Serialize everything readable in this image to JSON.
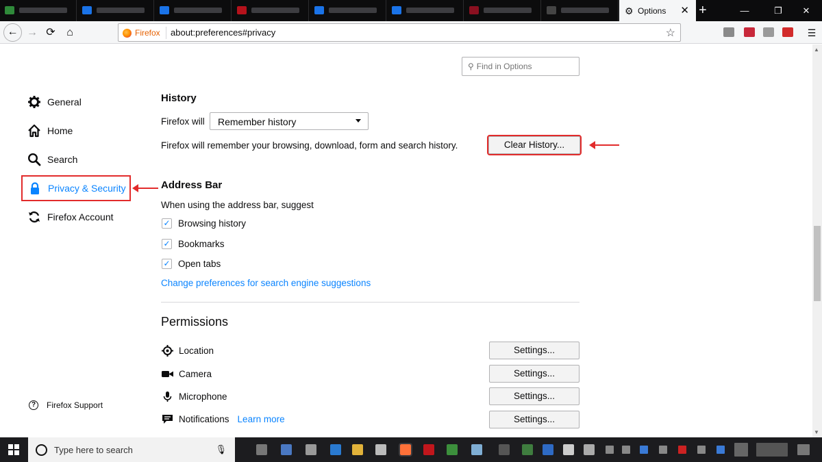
{
  "window": {
    "active_tab_title": "Options",
    "close_tab_glyph": "✕",
    "new_tab_glyph": "+",
    "minimize_glyph": "—",
    "restore_glyph": "❐",
    "close_glyph": "✕"
  },
  "toolbar": {
    "identity_label": "Firefox",
    "url": "about:preferences#privacy",
    "back_glyph": "←",
    "forward_glyph": "→",
    "reload_glyph": "⟳",
    "home_glyph": "⌂",
    "bookmark_glyph": "☆"
  },
  "search": {
    "placeholder": "Find in Options"
  },
  "sidebar": {
    "items": [
      {
        "label": "General",
        "icon": "gear-icon"
      },
      {
        "label": "Home",
        "icon": "home-icon"
      },
      {
        "label": "Search",
        "icon": "search-icon"
      },
      {
        "label": "Privacy & Security",
        "icon": "lock-icon",
        "selected": true
      },
      {
        "label": "Firefox Account",
        "icon": "sync-icon"
      }
    ],
    "support_label": "Firefox Support"
  },
  "history": {
    "heading": "History",
    "will_label": "Firefox will",
    "mode_value": "Remember history",
    "description": "Firefox will remember your browsing, download, form and search history.",
    "clear_button": "Clear History..."
  },
  "address_bar": {
    "heading": "Address Bar",
    "intro": "When using the address bar, suggest",
    "options": [
      {
        "label": "Browsing history",
        "checked": true
      },
      {
        "label": "Bookmarks",
        "checked": true
      },
      {
        "label": "Open tabs",
        "checked": true
      }
    ],
    "link": "Change preferences for search engine suggestions"
  },
  "permissions": {
    "heading": "Permissions",
    "items": [
      {
        "label": "Location",
        "icon": "location-icon",
        "button": "Settings..."
      },
      {
        "label": "Camera",
        "icon": "camera-icon",
        "button": "Settings..."
      },
      {
        "label": "Microphone",
        "icon": "microphone-icon",
        "button": "Settings..."
      },
      {
        "label": "Notifications",
        "icon": "notifications-icon",
        "button": "Settings...",
        "link": "Learn more"
      }
    ]
  },
  "taskbar": {
    "search_placeholder": "Type here to search"
  },
  "colors": {
    "accent": "#0a84ff",
    "annotation": "#e22b2b"
  }
}
